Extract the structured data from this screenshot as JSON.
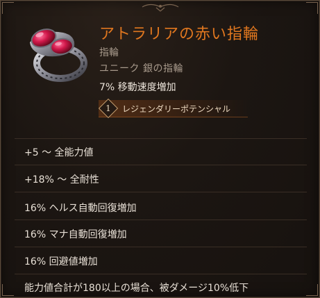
{
  "item": {
    "name": "アトラリアの赤い指輪",
    "type": "指輪",
    "rarity_line": "ユニーク 銀の指輪",
    "implicit": "7% 移動速度増加",
    "legendary_potential": {
      "count": "1",
      "label": "レジェンダリーポテンシャル"
    },
    "affixes": [
      "+5 〜 全能力値",
      "+18% 〜 全耐性",
      "16% ヘルス自動回復増加",
      "16% マナ自動回復増加",
      "16% 回避値増加",
      "能力値合計が180以上の場合、被ダメージ10%低下"
    ]
  },
  "colors": {
    "title": "#e0771f",
    "subtext": "#a89a8c",
    "stat_text": "#e8e0d6",
    "gem": "#d0184a",
    "background": "#1c1612"
  },
  "icons": {
    "item_image": "ruby-silver-ring-icon",
    "legendary": "diamond-number-icon"
  }
}
